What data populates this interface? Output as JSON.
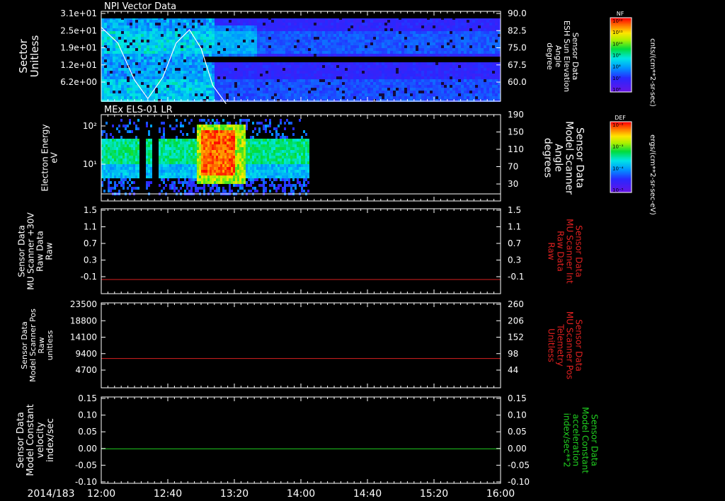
{
  "date_label": "2014/183",
  "time_ticks": [
    "12:00",
    "12:40",
    "13:20",
    "14:00",
    "14:40",
    "15:20",
    "16:00"
  ],
  "chart_data": [
    {
      "type": "heatmap",
      "title": "NPI Vector Data",
      "ylabel_left": [
        "Sector",
        "Unitless"
      ],
      "left_ticks": [
        "3.1e+01",
        "2.5e+01",
        "1.9e+01",
        "1.2e+01",
        "6.2e+00"
      ],
      "right_ticks": [
        "90.0",
        "82.5",
        "75.0",
        "67.5",
        "60.0"
      ],
      "ylabel_right": [
        "Sensor Data",
        "ESH Sun Elevation",
        "Angle",
        "degree"
      ],
      "overlay_series": {
        "name": "ESH Sun Elevation Angle",
        "time": [
          "12:00",
          "12:10",
          "12:20",
          "12:28",
          "12:37",
          "12:45",
          "12:53",
          "13:00",
          "13:07",
          "13:15"
        ],
        "values": [
          84,
          78,
          64,
          57,
          65,
          78,
          83,
          76,
          62,
          55
        ]
      },
      "colorbar": {
        "label": "NF",
        "unit": "cnts/(cm**2-sr-sec)",
        "tick_labels": [
          "10¹²",
          "10¹¹",
          "10¹⁰",
          "10⁹",
          "10⁸",
          "10⁷",
          "10⁶"
        ]
      }
    },
    {
      "type": "heatmap",
      "title": "MEx ELS-01 LR",
      "ylabel_left": [
        "Electron Energy",
        "eV"
      ],
      "left_ticks": [
        "10²",
        "10¹"
      ],
      "right_ticks": [
        "190",
        "150",
        "110",
        "70",
        "30"
      ],
      "ylabel_right": [
        "Sensor Data",
        "Model Scanner",
        "Angle",
        "degrees"
      ],
      "data_end_time": "14:05",
      "colorbar": {
        "label": "DEF",
        "unit": "ergs/(cm**2-sr-sec-eV)",
        "tick_labels": [
          "10⁻²",
          "10⁻³",
          "10⁻⁴",
          "10⁻⁵"
        ]
      }
    },
    {
      "type": "line",
      "ylabel_left": [
        "Sensor Data",
        "MU Scanner +30V",
        "Raw Data",
        "Raw"
      ],
      "left_ticks": [
        "1.5",
        "1.1",
        "0.7",
        "0.3",
        "-0.1"
      ],
      "right_ticks": [
        "1.5",
        "1.1",
        "0.7",
        "0.3",
        "-0.1"
      ],
      "ylabel_right": [
        "Sensor Data",
        "MU Scanner Int",
        "Raw Data",
        "Raw"
      ],
      "series": [
        {
          "color": "#d82020",
          "time": [
            "12:00",
            "16:00"
          ],
          "values": [
            0.0,
            0.0
          ]
        }
      ]
    },
    {
      "type": "line",
      "ylabel_left": [
        "Sensor Data",
        "Model Scanner Pos",
        "Raw",
        "unitless"
      ],
      "left_ticks": [
        "23500",
        "18800",
        "14100",
        "9400",
        "4700"
      ],
      "right_ticks": [
        "260",
        "206",
        "152",
        "98",
        "44"
      ],
      "ylabel_right": [
        "Sensor Data",
        "MU Scanner Pos",
        "Telemetry",
        "Unitless"
      ],
      "series": [
        {
          "color": "#d82020",
          "time": [
            "12:00",
            "16:00"
          ],
          "values": [
            8100,
            8100
          ]
        }
      ]
    },
    {
      "type": "line",
      "ylabel_left": [
        "Sensor Data",
        "Model Constant",
        "velocity",
        "index/sec"
      ],
      "left_ticks": [
        "0.15",
        "0.10",
        "0.05",
        "0.00",
        "-0.05",
        "-0.10"
      ],
      "right_ticks": [
        "0.15",
        "0.10",
        "0.05",
        "0.00",
        "-0.05",
        "-0.10"
      ],
      "ylabel_right": [
        "Sensor Data",
        "Model Constant",
        "acceleration",
        "index/sec**2"
      ],
      "series": [
        {
          "color": "#20d020",
          "time": [
            "12:00",
            "16:00"
          ],
          "values": [
            0.0,
            0.0
          ]
        }
      ]
    }
  ]
}
